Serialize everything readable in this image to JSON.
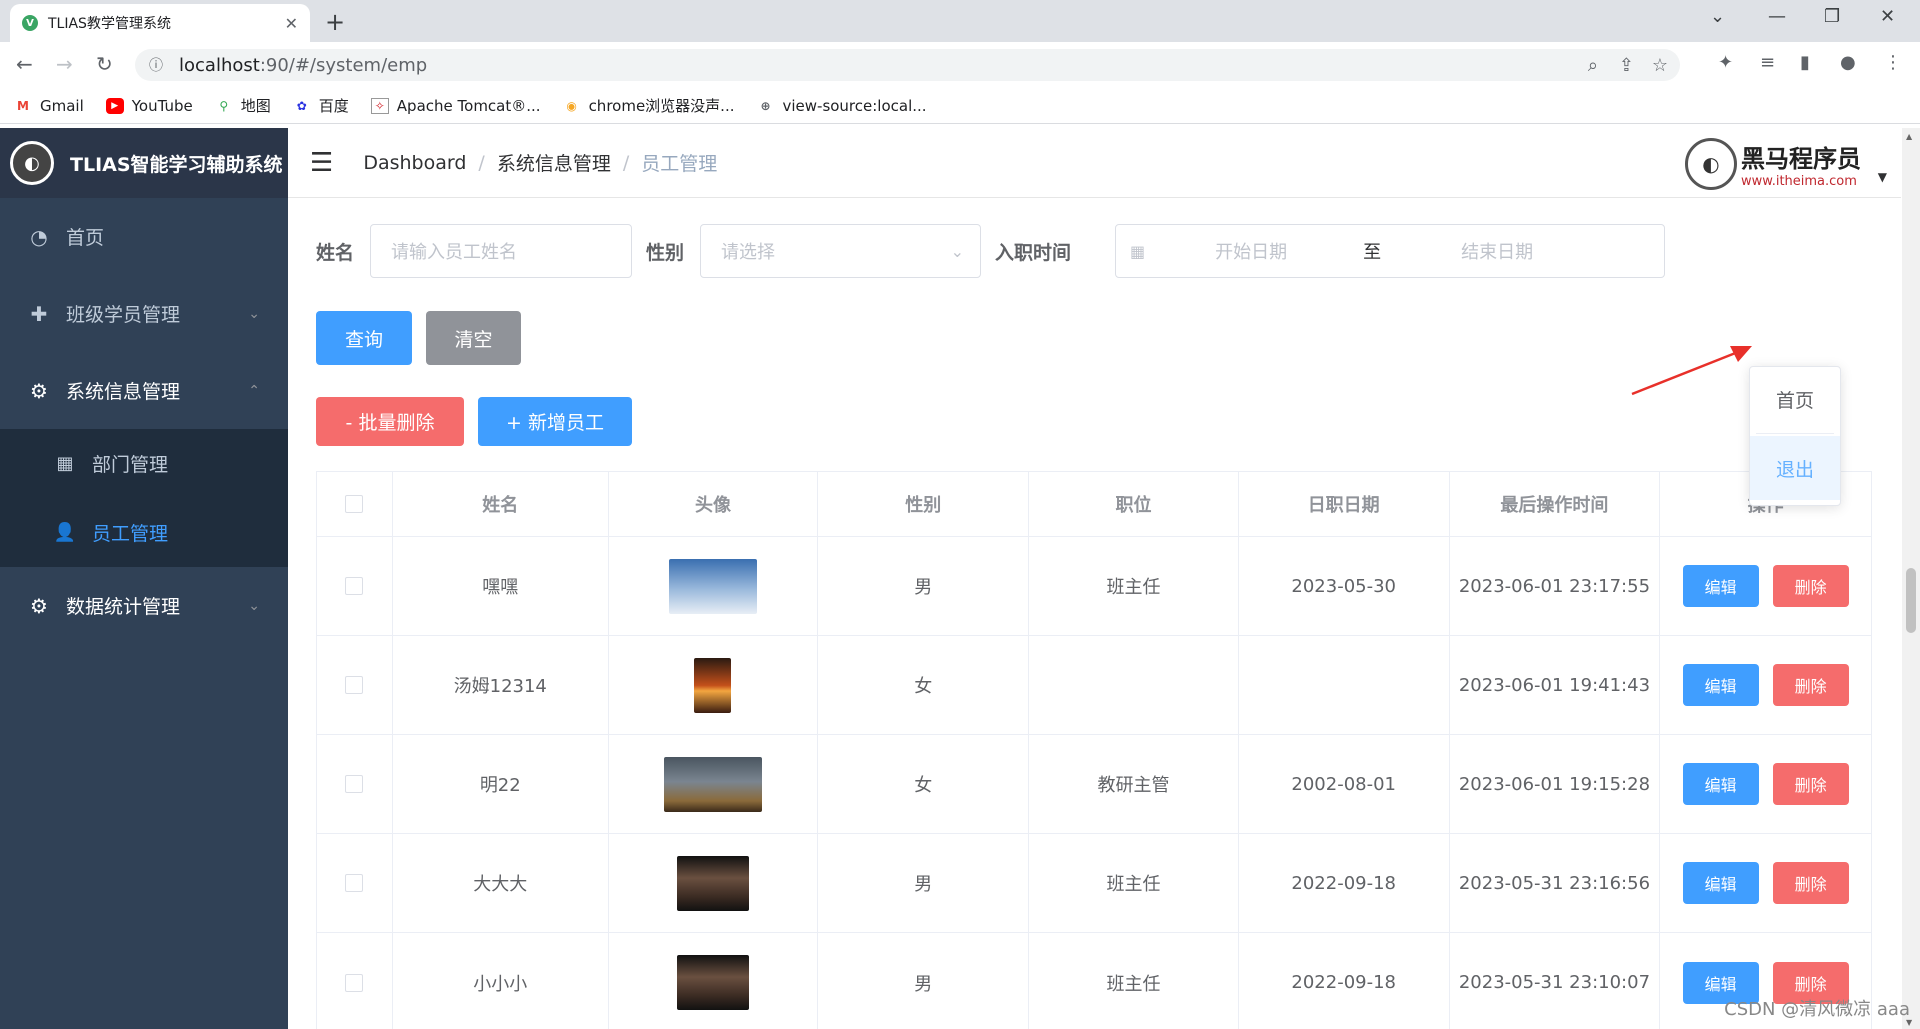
{
  "browser": {
    "tab_title": "TLIAS教学管理系统",
    "url_host": "localhost",
    "url_rest": ":90/#/system/emp",
    "bookmarks": [
      {
        "label": "Gmail",
        "icon": "gmail-icon"
      },
      {
        "label": "YouTube",
        "icon": "youtube-icon"
      },
      {
        "label": "地图",
        "icon": "maps-icon"
      },
      {
        "label": "百度",
        "icon": "baidu-icon"
      },
      {
        "label": "Apache Tomcat®...",
        "icon": "tomcat-icon"
      },
      {
        "label": "chrome浏览器没声...",
        "icon": "chrome-icon"
      },
      {
        "label": "view-source:local...",
        "icon": "globe-icon"
      }
    ]
  },
  "sidebar": {
    "title": "TLIAS智能学习辅助系统",
    "items": [
      {
        "label": "首页",
        "icon": "dashboard-icon"
      },
      {
        "label": "班级学员管理",
        "icon": "class-icon"
      },
      {
        "label": "系统信息管理",
        "icon": "gear-icon"
      },
      {
        "label": "数据统计管理",
        "icon": "gear-icon"
      }
    ],
    "sub_items": [
      {
        "label": "部门管理",
        "icon": "grid-icon"
      },
      {
        "label": "员工管理",
        "icon": "user-icon"
      }
    ]
  },
  "breadcrumb": {
    "root": "Dashboard",
    "parent": "系统信息管理",
    "current": "员工管理"
  },
  "brand": {
    "name": "黑马程序员",
    "url": "www.itheima.com"
  },
  "search": {
    "name_label": "姓名",
    "name_placeholder": "请输入员工姓名",
    "gender_label": "性别",
    "gender_placeholder": "请选择",
    "date_label": "入职时间",
    "start_placeholder": "开始日期",
    "to": "至",
    "end_placeholder": "结束日期",
    "query": "查询",
    "clear": "清空",
    "batch_delete": "- 批量删除",
    "add_employee": "+ 新增员工"
  },
  "dropdown": {
    "home": "首页",
    "logout": "退出"
  },
  "table": {
    "headers": [
      "姓名",
      "头像",
      "性别",
      "职位",
      "日职日期",
      "最后操作时间",
      "操作"
    ],
    "edit_label": "编辑",
    "delete_label": "删除",
    "rows": [
      {
        "name": "嘿嘿",
        "gender": "男",
        "position": "班主任",
        "entry_date": "2023-05-30",
        "update_time": "2023-06-01 23:17:55"
      },
      {
        "name": "汤姆12314",
        "gender": "女",
        "position": "",
        "entry_date": "",
        "update_time": "2023-06-01 19:41:43"
      },
      {
        "name": "明22",
        "gender": "女",
        "position": "教研主管",
        "entry_date": "2002-08-01",
        "update_time": "2023-06-01 19:15:28"
      },
      {
        "name": "大大大",
        "gender": "男",
        "position": "班主任",
        "entry_date": "2022-09-18",
        "update_time": "2023-05-31 23:16:56"
      },
      {
        "name": "小小小",
        "gender": "男",
        "position": "班主任",
        "entry_date": "2022-09-18",
        "update_time": "2023-05-31 23:10:07"
      }
    ]
  },
  "watermark": "CSDN @清风微凉 aaa"
}
